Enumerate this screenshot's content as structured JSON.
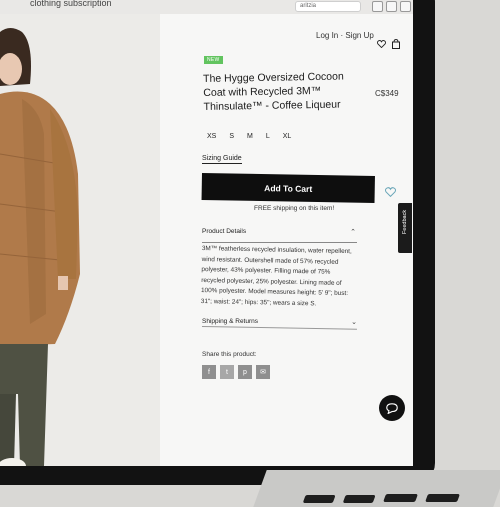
{
  "browser": {
    "tab_title": "clothing subscription",
    "url_fragment": "aritzia"
  },
  "header": {
    "login_label": "Log In · Sign Up"
  },
  "product": {
    "badge": "NEW",
    "title": "The Hygge Oversized Cocoon Coat with Recycled 3M™ Thinsulate™ - Coffee Liqueur",
    "price": "C$349",
    "sizes": [
      "XS",
      "S",
      "M",
      "L",
      "XL"
    ],
    "sizing_guide_label": "Sizing Guide",
    "add_to_cart_label": "Add To Cart",
    "free_shipping": "FREE shipping on this item!"
  },
  "details": {
    "heading": "Product Details",
    "text": "3M™ featherless recycled insulation, water repellent, wind resistant. Outershell made of 57% recycled polyester, 43% polyester. Filling made of 75% recycled polyester, 25% polyester. Lining made of 100% polyester. Model measures height: 5' 9\"; bust: 31\"; waist: 24\"; hips: 35\"; wears a size S."
  },
  "shipping": {
    "heading": "Shipping & Returns"
  },
  "share": {
    "label": "Share this product:",
    "buttons": [
      {
        "name": "facebook",
        "glyph": "f"
      },
      {
        "name": "twitter",
        "glyph": "t"
      },
      {
        "name": "pinterest",
        "glyph": "p"
      },
      {
        "name": "email",
        "glyph": "✉"
      }
    ]
  },
  "feedback": {
    "label": "Feedback"
  },
  "colors": {
    "badge_green": "#62c45f",
    "cart_black": "#0e0e0e",
    "coat_tan": "#b07a4a"
  }
}
